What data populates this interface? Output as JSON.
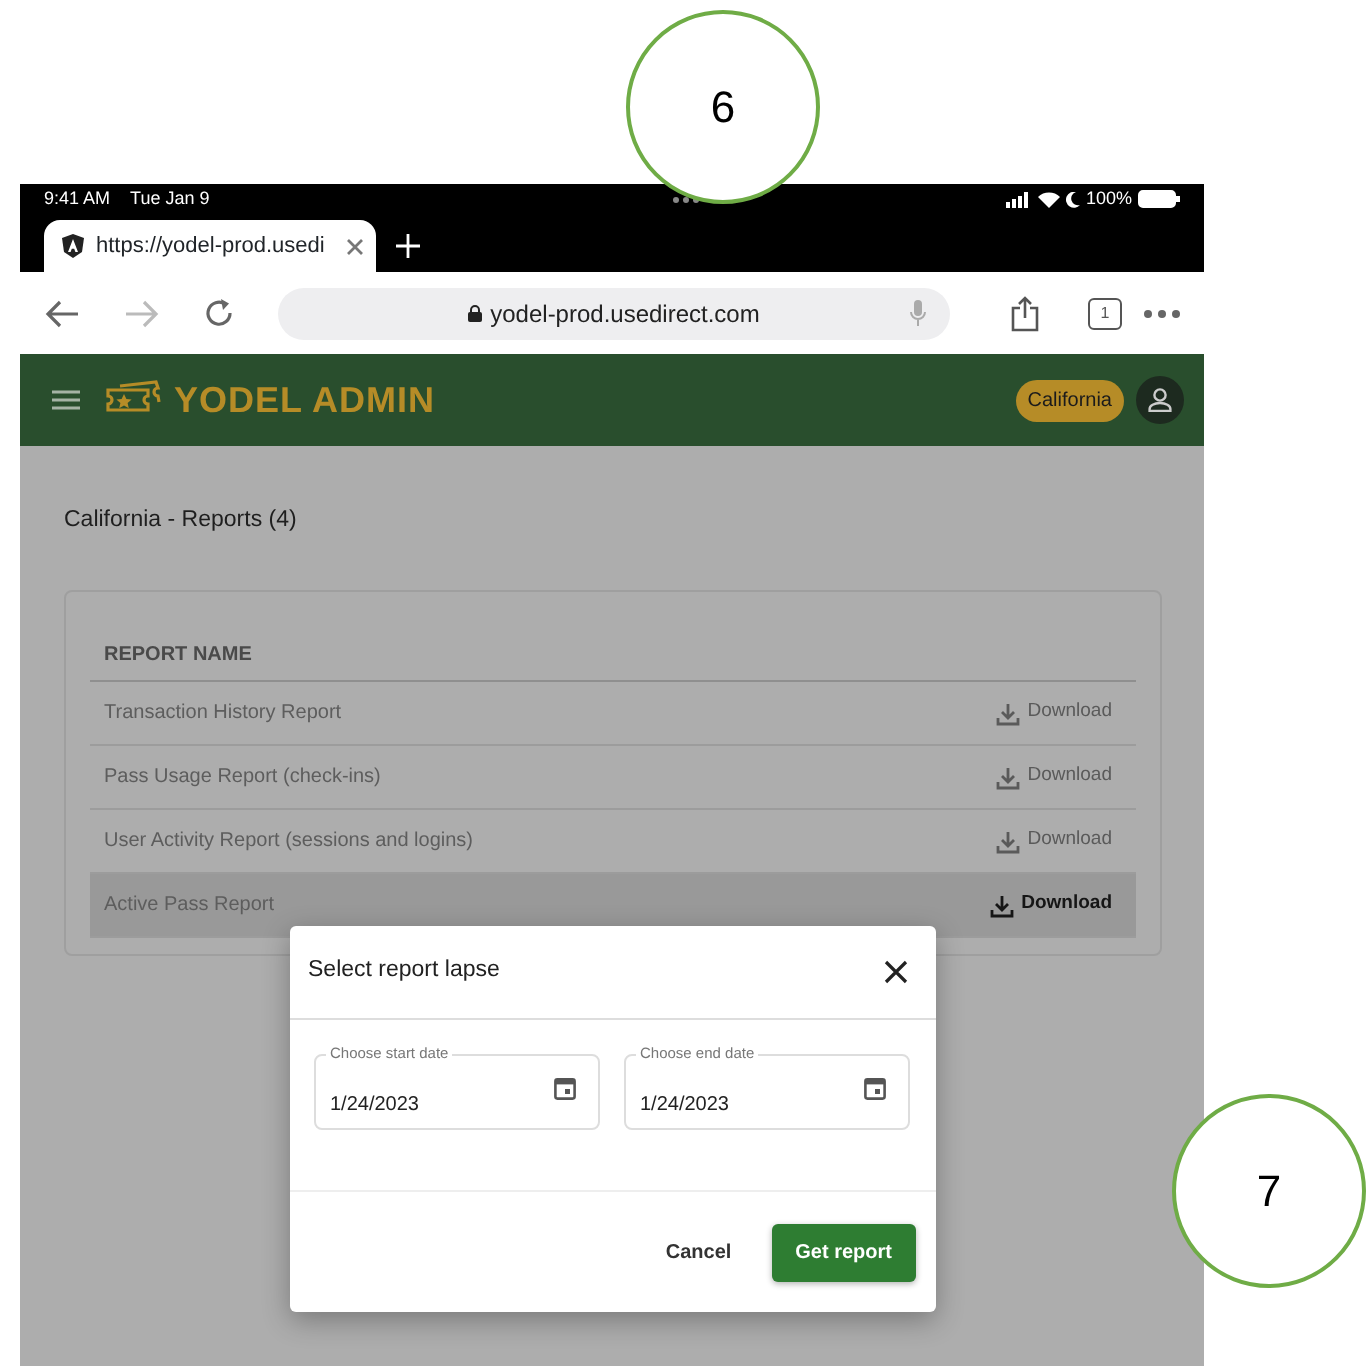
{
  "callouts": [
    {
      "label": "6"
    },
    {
      "label": "7"
    }
  ],
  "status_bar": {
    "time": "9:41 AM",
    "date": "Tue Jan 9",
    "battery": "100%"
  },
  "browser": {
    "tab_title": "https://yodel-prod.usedi",
    "url": "yodel-prod.usedirect.com",
    "tab_count": "1"
  },
  "app": {
    "title": "YODEL ADMIN",
    "region_badge": "California"
  },
  "page_title": "California - Reports (4)",
  "table": {
    "columns": [
      "REPORT NAME"
    ],
    "rows": [
      {
        "name": "Transaction History Report",
        "action": "Download",
        "disabled": true,
        "selected": false
      },
      {
        "name": "Pass Usage Report (check-ins)",
        "action": "Download",
        "disabled": true,
        "selected": false
      },
      {
        "name": "User Activity Report (sessions and logins)",
        "action": "Download",
        "disabled": true,
        "selected": false
      },
      {
        "name": "Active Pass Report",
        "action": "Download",
        "disabled": false,
        "selected": true
      }
    ]
  },
  "dialog": {
    "title": "Select report lapse",
    "fields": [
      {
        "label": "Choose start date",
        "value": "1/24/2023"
      },
      {
        "label": "Choose end date",
        "value": "1/24/2023"
      }
    ],
    "buttons": [
      {
        "label": "Cancel",
        "kind": "text"
      },
      {
        "label": "Get report",
        "kind": "primary"
      }
    ]
  }
}
